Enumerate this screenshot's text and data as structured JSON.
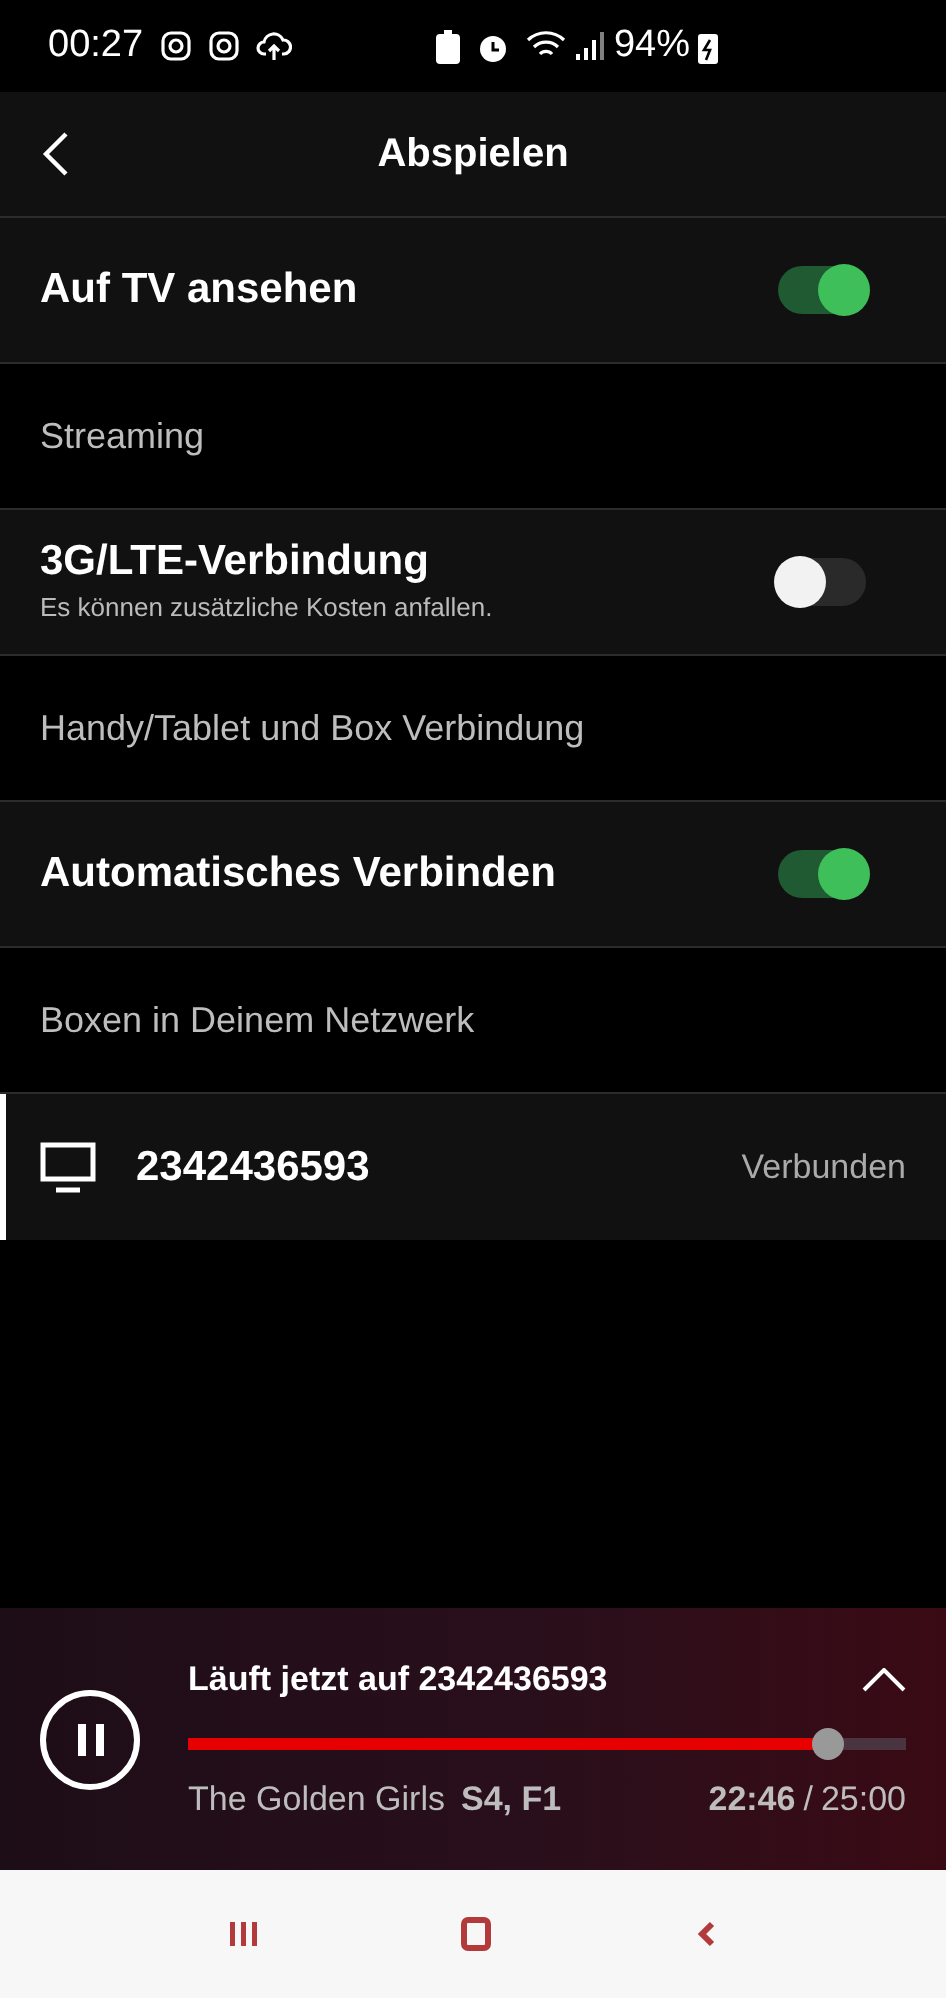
{
  "status_bar": {
    "time": "00:27",
    "battery": "94%"
  },
  "header": {
    "title": "Abspielen"
  },
  "rows": [
    {
      "kind": "toggle",
      "label": "Auf TV ansehen",
      "on": true
    },
    {
      "kind": "section",
      "label": "Streaming"
    },
    {
      "kind": "toggle",
      "label": "3G/LTE-Verbindung",
      "sublabel": "Es können zusätzliche Kosten anfallen.",
      "on": false
    },
    {
      "kind": "section",
      "label": "Handy/Tablet und Box Verbindung"
    },
    {
      "kind": "toggle",
      "label": "Automatisches Verbinden",
      "on": true
    },
    {
      "kind": "section",
      "label": "Boxen in Deinem Netzwerk"
    },
    {
      "kind": "device",
      "label": "2342436593",
      "status": "Verbunden",
      "selected": true
    }
  ],
  "player": {
    "title": "Läuft jetzt auf 2342436593",
    "level": 0.89,
    "show": "The Golden Girls",
    "episode": "S4, F1",
    "elapsed": "22:46",
    "separator": "/",
    "total": "25:00"
  }
}
